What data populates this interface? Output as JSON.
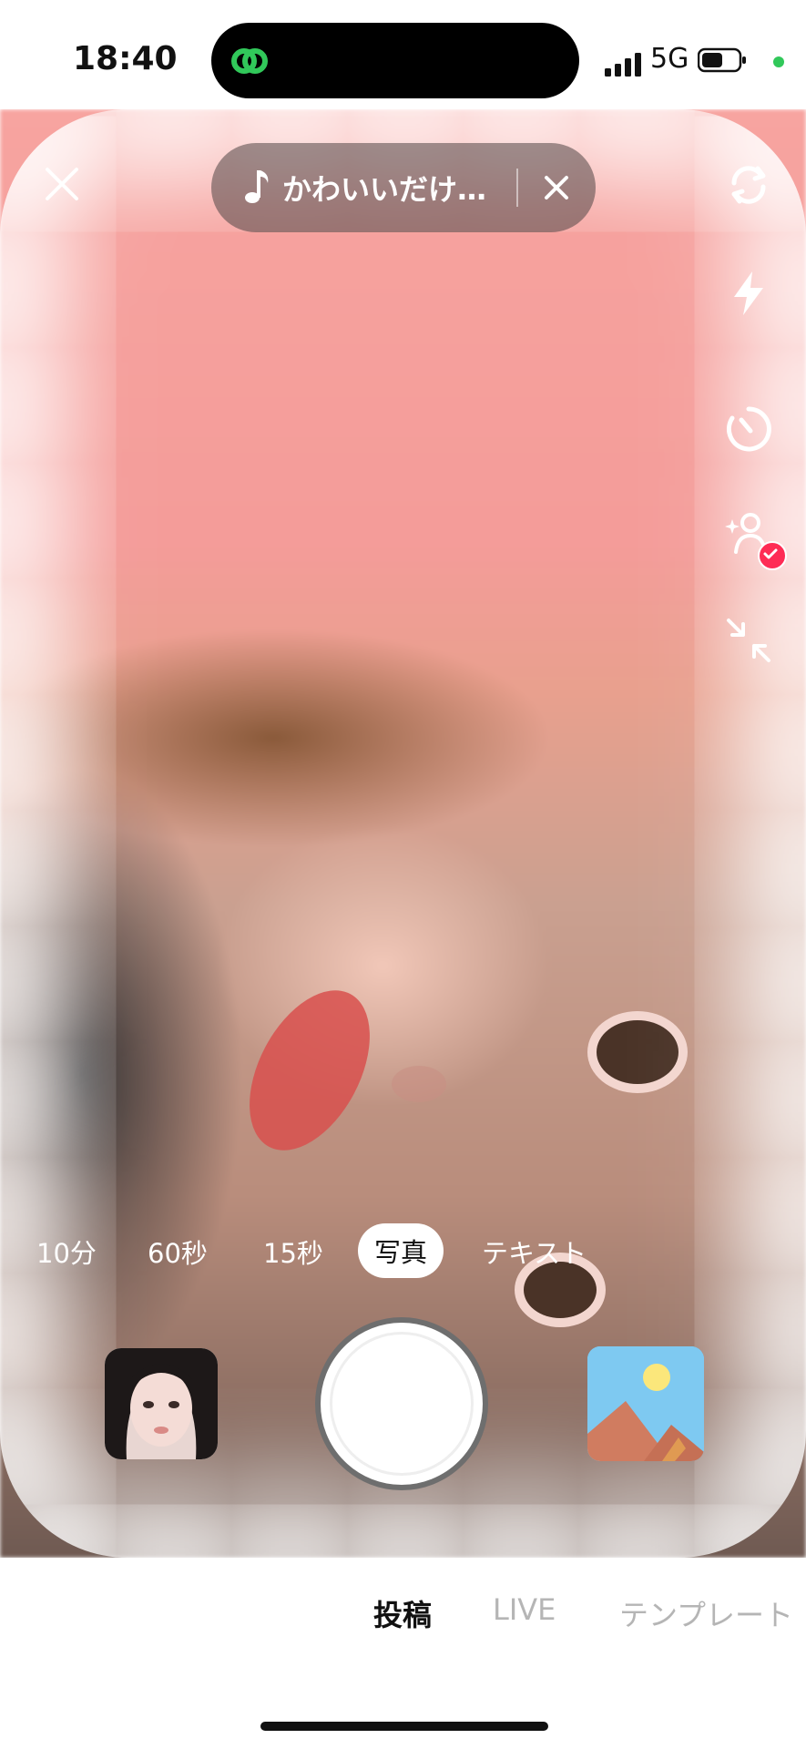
{
  "status_bar": {
    "time": "18:40",
    "network": "5G",
    "icons": [
      "link-icon",
      "signal-icon",
      "battery-icon",
      "privacy-dot"
    ]
  },
  "music": {
    "title": "かわいいだけ…",
    "note_icon": "music-note-icon",
    "remove_icon": "close-icon"
  },
  "right_rail": {
    "icons": [
      "flip-camera-icon",
      "flash-icon",
      "timer-icon",
      "beauty-icon",
      "collapse-icon"
    ]
  },
  "modes": {
    "items": [
      "10分",
      "60秒",
      "15秒",
      "写真",
      "テキスト"
    ],
    "selected": "写真"
  },
  "bottom_tabs": {
    "post": "投稿",
    "live": "LIVE",
    "template": "テンプレート"
  },
  "colors": {
    "accent": "#fe2c55",
    "island_icon": "#31c85a"
  }
}
